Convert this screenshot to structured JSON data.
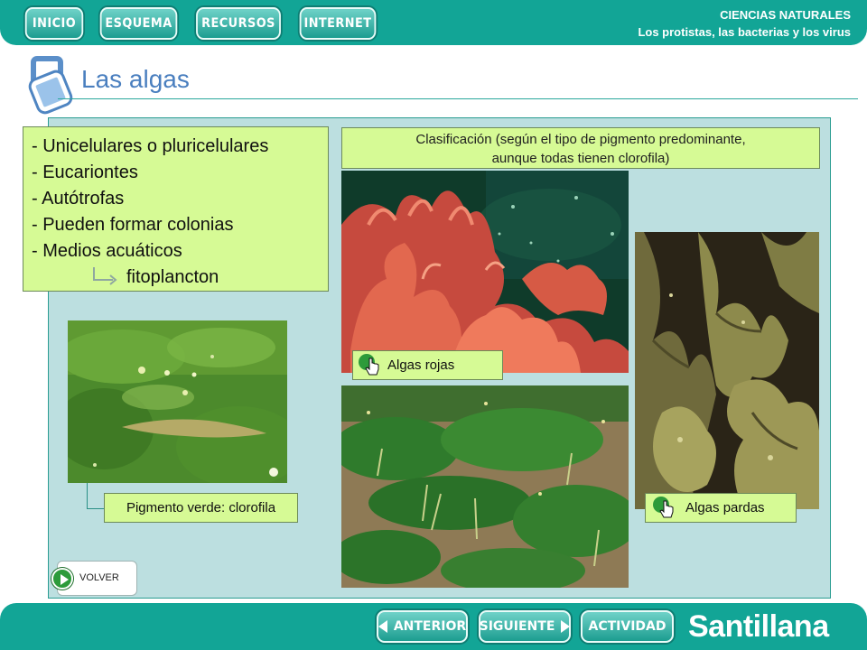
{
  "header": {
    "nav": [
      "INICIO",
      "ESQUEMA",
      "RECURSOS",
      "INTERNET"
    ],
    "subject": "CIENCIAS NATURALES",
    "unit": "Los protistas, las bacterias y los virus"
  },
  "page": {
    "title": "Las algas"
  },
  "features": {
    "items": [
      "- Unicelulares o pluricelulares",
      "- Eucariontes",
      "- Autótrofas",
      "- Pueden formar colonias",
      "- Medios acuáticos"
    ],
    "sub_item": "fitoplancton"
  },
  "classification": {
    "line1": "Clasificación (según el tipo de pigmento predominante,",
    "line2": "aunque todas tienen clorofila)"
  },
  "labels": {
    "red_algae": "Algas rojas",
    "brown_algae": "Algas pardas",
    "green_pigment": "Pigmento verde: clorofila"
  },
  "volver_label": "VOLVER",
  "footer": {
    "prev_label": "ANTERIOR",
    "next_label": "SIGUIENTE",
    "activity_label": "ACTIVIDAD",
    "brand": "Santillana"
  },
  "colors": {
    "bar": "#12a596",
    "panel": "#bcdfe0",
    "label_bg": "#d6fa95",
    "title": "#4a7fbf"
  },
  "icons": [
    "pointer-hand-icon",
    "return-arrow-icon",
    "play-icon",
    "arrow-left-icon",
    "arrow-right-icon"
  ]
}
